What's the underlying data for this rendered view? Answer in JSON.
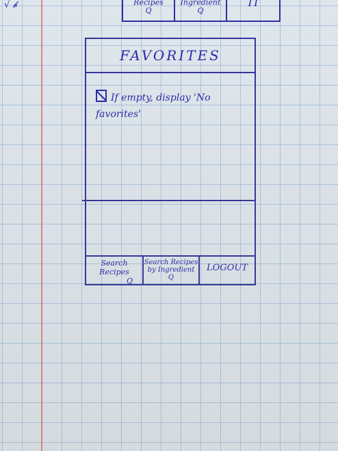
{
  "previous_page": {
    "left_scribble": "√ 𝓫",
    "nav": [
      {
        "label": "Recipes",
        "icon": "Q"
      },
      {
        "label": "Ingredient",
        "icon": "Q"
      },
      {
        "label": "IT"
      }
    ]
  },
  "screen": {
    "title": "FAVORITES",
    "empty_note": "If empty, display 'No favorites'",
    "nav": [
      {
        "label": "Search Recipes",
        "icon": "Q"
      },
      {
        "label": "Search Recipes by Ingredient",
        "icon": "Q"
      },
      {
        "label": "LOGOUT"
      }
    ]
  },
  "colors": {
    "ink": "#2a2aa8",
    "grid": "#6996c8",
    "margin": "#e15f55",
    "paper": "#dfe6ec"
  }
}
